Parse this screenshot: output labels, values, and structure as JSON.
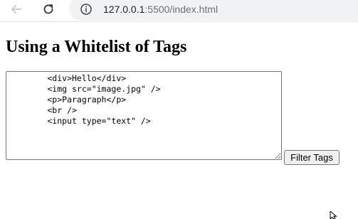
{
  "browser": {
    "url_host": "127.0.0.1",
    "url_rest": ":5500/index.html"
  },
  "page": {
    "title": "Using a Whitelist of Tags",
    "textarea_value": "        <div>Hello</div>\n        <img src=\"image.jpg\" />\n        <p>Paragraph</p>\n        <br />\n        <input type=\"text\" />",
    "filter_button_label": "Filter Tags"
  },
  "icons": {
    "back": "back-arrow-icon",
    "reload": "reload-icon",
    "info": "info-icon",
    "cursor": "mouse-cursor-icon"
  }
}
